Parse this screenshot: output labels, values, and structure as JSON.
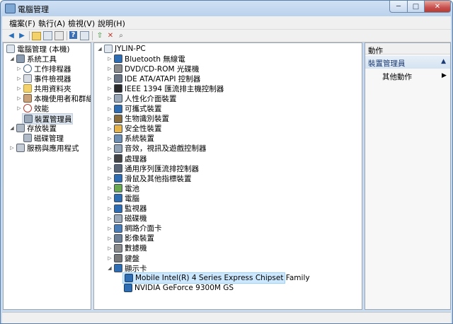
{
  "window": {
    "title": "電腦管理",
    "buttons": {
      "minimize": "─",
      "maximize": "□",
      "close": "✕"
    }
  },
  "menubar": {
    "items": [
      "檔案(F)",
      "執行(A)",
      "檢視(V)",
      "說明(H)"
    ]
  },
  "toolbar": {
    "icons": [
      "back-icon",
      "forward-icon",
      "up-folder-icon",
      "show-hide-tree-icon",
      "export-icon",
      "properties-icon",
      "help-icon",
      "console-icon",
      "update-driver-icon",
      "uninstall-icon",
      "scan-hardware-icon"
    ]
  },
  "left_tree": {
    "root": "電腦管理 (本機)",
    "system_tools": "系統工具",
    "system_children": [
      "工作排程器",
      "事件檢視器",
      "共用資料夾",
      "本機使用者和群組",
      "效能",
      "裝置管理員"
    ],
    "storage": "存放裝置",
    "storage_children": [
      "磁碟管理"
    ],
    "services": "服務與應用程式"
  },
  "device_tree": {
    "computer": "JYLIN-PC",
    "categories": [
      "Bluetooth 無線電",
      "DVD/CD-ROM 光碟機",
      "IDE ATA/ATAPI 控制器",
      "IEEE 1394 匯流排主機控制器",
      "人性化介面裝置",
      "可攜式裝置",
      "生物識別裝置",
      "安全性裝置",
      "系統裝置",
      "音效，視訊及遊戲控制器",
      "處理器",
      "通用序列匯流排控制器",
      "滑鼠及其他指標裝置",
      "電池",
      "電腦",
      "監視器",
      "磁碟機",
      "網路介面卡",
      "影像裝置",
      "數據機",
      "鍵盤",
      "顯示卡"
    ],
    "display_adapters": [
      "Mobile Intel(R) 4 Series Express Chipset Family",
      "NVIDIA GeForce 9300M GS"
    ]
  },
  "actions": {
    "header": "動作",
    "section": "裝置管理員",
    "more": "其他動作"
  },
  "colors": {
    "selection": "#cce8ff",
    "title_gradient_top": "#cfe0f3",
    "close_button": "#c75050"
  }
}
